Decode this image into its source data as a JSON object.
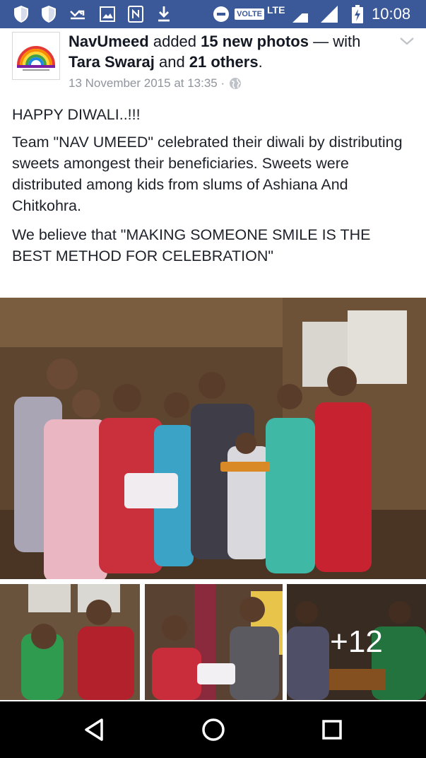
{
  "status_bar": {
    "time": "10:08",
    "volte": "VOLTE",
    "lte": "LTE",
    "icons": [
      "shield-icon",
      "shield-icon",
      "missed-call-icon",
      "image-icon",
      "nfc-icon",
      "download-icon",
      "do-not-disturb-icon",
      "signal-icon",
      "signal-icon",
      "battery-charging-icon"
    ],
    "color": "#3b5998"
  },
  "post": {
    "page_name": "NavUmeed",
    "action": "added",
    "photo_count": "15 new photos",
    "with_text": "— with",
    "tagged_person": "Tara Swaraj",
    "and_text": "and",
    "others": "21 others",
    "period": ".",
    "timestamp": "13 November 2015 at 13:35 ·",
    "privacy_icon": "globe-icon",
    "menu_icon": "chevron-down-icon",
    "paragraphs": [
      "HAPPY DIWALI..!!!",
      "Team \"NAV UMEED\" celebrated their diwali by distributing sweets amongest their beneficiaries. Sweets were distributed among kids from slums of Ashiana And Chitkohra.",
      "We believe that \"MAKING SOMEONE SMILE IS THE BEST METHOD FOR CELEBRATION\""
    ]
  },
  "photos": {
    "more_count": "+12"
  },
  "nav_bar": {
    "back_icon": "back-triangle-icon",
    "home_icon": "home-circle-icon",
    "recents_icon": "recents-square-icon"
  }
}
